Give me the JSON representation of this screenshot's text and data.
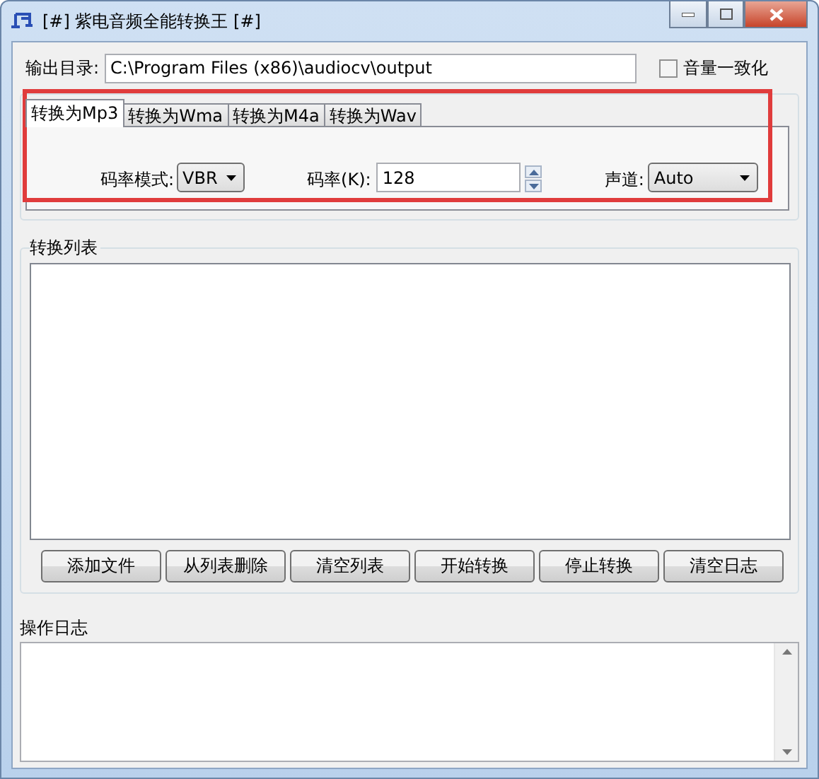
{
  "window": {
    "title": "[#] 紫电音频全能转换王 [#]"
  },
  "output": {
    "label": "输出目录:",
    "value": "C:\\Program Files (x86)\\audiocv\\output"
  },
  "normalize": {
    "label": "音量一致化",
    "checked": false
  },
  "tabs": [
    {
      "label": "转换为Mp3",
      "selected": true
    },
    {
      "label": "转换为Wma",
      "selected": false
    },
    {
      "label": "转换为M4a",
      "selected": false
    },
    {
      "label": "转换为Wav",
      "selected": false
    }
  ],
  "settings": {
    "mode_label": "码率模式:",
    "mode_value": "VBR",
    "bitrate_label": "码率(K):",
    "bitrate_value": "128",
    "channel_label": "声道:",
    "channel_value": "Auto"
  },
  "list": {
    "title": "转换列表"
  },
  "buttons": [
    "添加文件",
    "从列表删除",
    "清空列表",
    "开始转换",
    "停止转换",
    "清空日志"
  ],
  "log": {
    "title": "操作日志"
  }
}
